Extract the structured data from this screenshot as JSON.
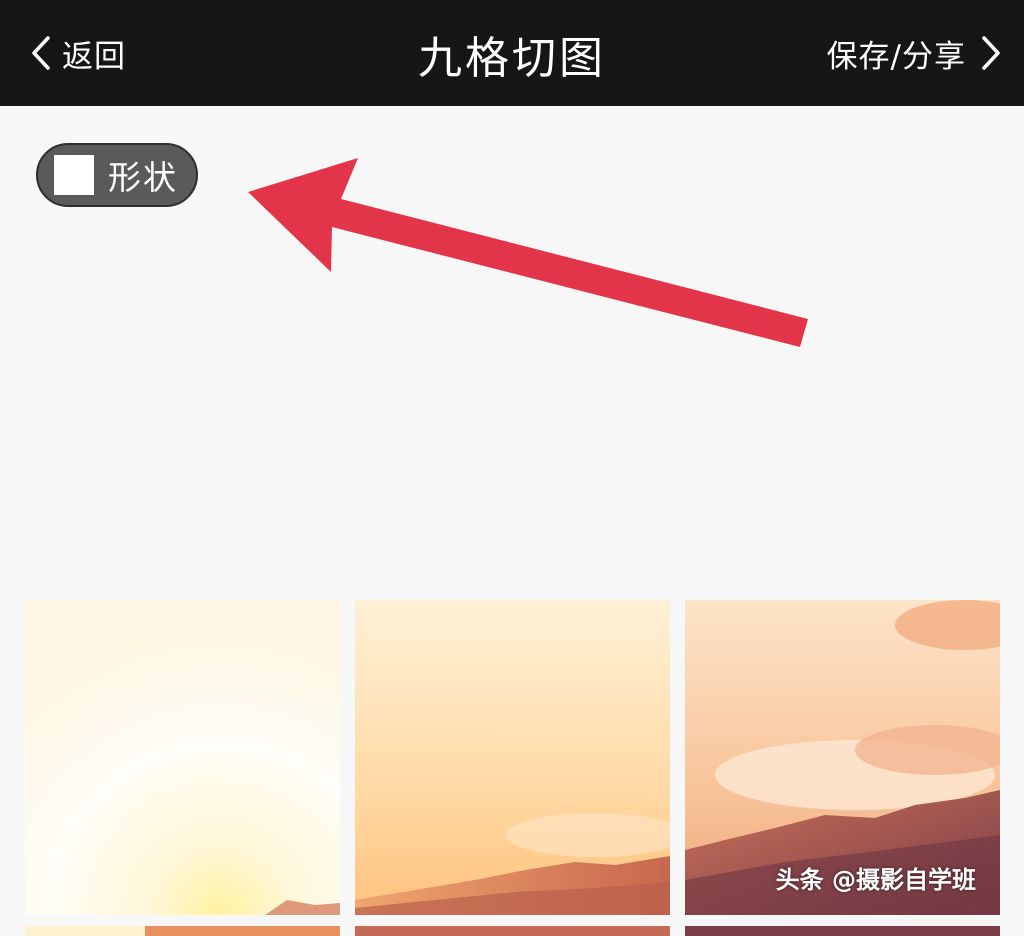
{
  "header": {
    "back_label": "返回",
    "title": "九格切图",
    "save_label": "保存/分享"
  },
  "toolbar": {
    "shape_label": "形状"
  },
  "icons": {
    "back": "chevron-left-icon",
    "save": "chevron-right-icon",
    "shape": "square-shape-icon"
  },
  "colors": {
    "header_bg": "#161616",
    "page_bg": "#f7f7f7",
    "pill_bg": "#5a5a5a",
    "annotation_arrow": "#e3354a"
  },
  "watermark": "头条 @摄影自学班"
}
